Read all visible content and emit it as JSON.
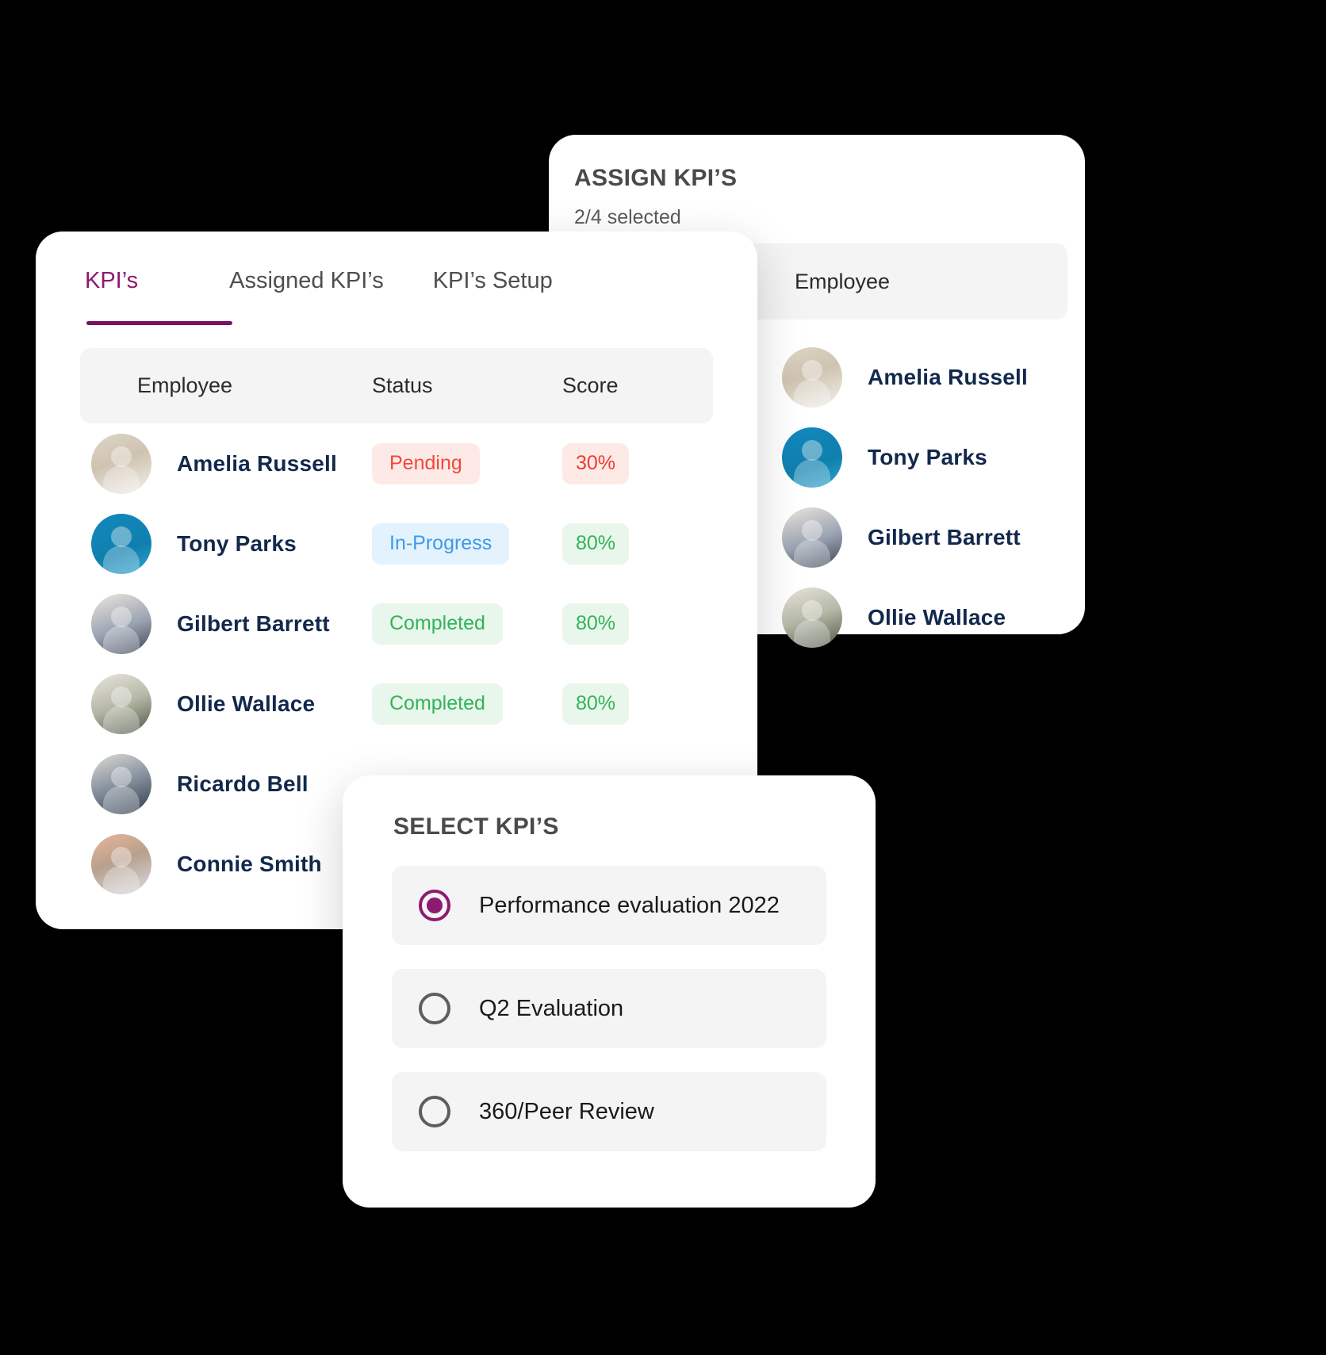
{
  "assign_panel": {
    "title": "ASSIGN KPI’S",
    "subtitle": "2/4 selected",
    "column_header": "Employee",
    "employees": [
      {
        "name": "Amelia Russell",
        "avatar": "av-amelia"
      },
      {
        "name": "Tony Parks",
        "avatar": "av-tony"
      },
      {
        "name": "Gilbert Barrett",
        "avatar": "av-gilbert"
      },
      {
        "name": "Ollie Wallace",
        "avatar": "av-ollie"
      }
    ]
  },
  "kpi_panel": {
    "tabs": [
      {
        "label": "KPI’s",
        "active": true
      },
      {
        "label": "Assigned KPI’s",
        "active": false
      },
      {
        "label": "KPI’s Setup",
        "active": false
      }
    ],
    "table": {
      "columns": [
        "Employee",
        "Status",
        "Score"
      ],
      "rows": [
        {
          "name": "Amelia Russell",
          "avatar": "av-amelia",
          "status": "Pending",
          "status_kind": "pending",
          "score": "30%",
          "score_kind": "low"
        },
        {
          "name": "Tony Parks",
          "avatar": "av-tony",
          "status": "In-Progress",
          "status_kind": "inprogress",
          "score": "80%",
          "score_kind": "high"
        },
        {
          "name": "Gilbert Barrett",
          "avatar": "av-gilbert",
          "status": "Completed",
          "status_kind": "completed",
          "score": "80%",
          "score_kind": "high"
        },
        {
          "name": "Ollie Wallace",
          "avatar": "av-ollie",
          "status": "Completed",
          "status_kind": "completed",
          "score": "80%",
          "score_kind": "high"
        },
        {
          "name": "Ricardo Bell",
          "avatar": "av-ricardo",
          "status": "",
          "status_kind": "blank",
          "score": "",
          "score_kind": "none"
        },
        {
          "name": "Connie Smith",
          "avatar": "av-connie",
          "status": "",
          "status_kind": "blank",
          "score": "",
          "score_kind": "none"
        }
      ]
    }
  },
  "select_panel": {
    "title": "SELECT KPI’S",
    "options": [
      {
        "label": "Performance evaluation 2022",
        "checked": true
      },
      {
        "label": "Q2  Evaluation",
        "checked": false
      },
      {
        "label": "360/Peer Review",
        "checked": false
      }
    ]
  },
  "colors": {
    "accent_purple": "#8c1a70",
    "tab_underline": "#7b1363",
    "name_navy": "#12284c",
    "pending_bg": "#fdeae7",
    "pending_fg": "#f1483b",
    "inprogress_bg": "#e4f2fd",
    "inprogress_fg": "#3d9ae8",
    "completed_bg": "#e8f6ec",
    "completed_fg": "#32b457",
    "header_row_bg": "#f4f4f4",
    "page_bg": "#000000"
  }
}
